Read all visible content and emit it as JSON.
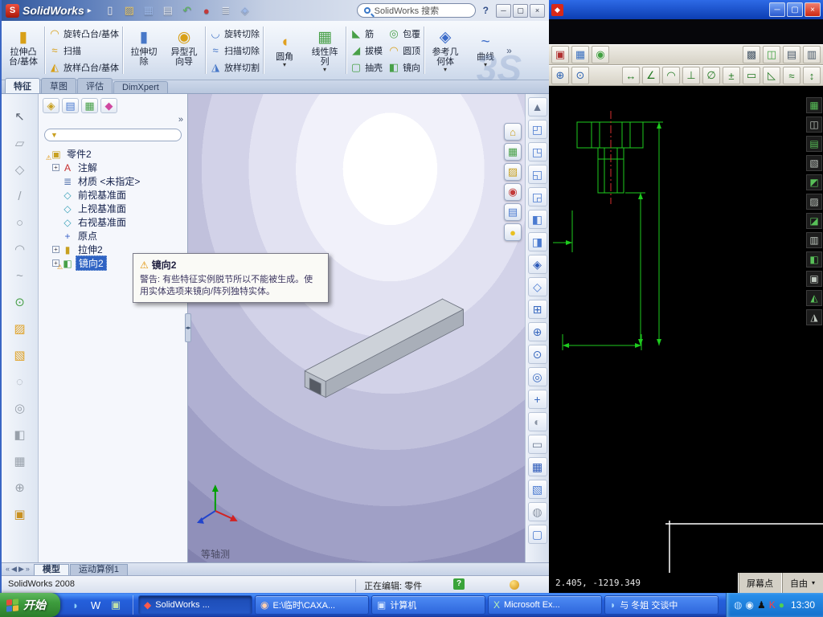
{
  "sw": {
    "titlebar": {
      "logo_text": "SolidWorks",
      "menu_arrow": "▸",
      "tools": [
        {
          "n": "new-document-icon",
          "g": "▯",
          "c": "#f8faff"
        },
        {
          "n": "open-icon",
          "g": "▨",
          "c": "#eac96a"
        },
        {
          "n": "save-icon",
          "g": "▦",
          "c": "#9db9ea"
        },
        {
          "n": "print-icon",
          "g": "▤",
          "c": "#e2e7f0"
        },
        {
          "n": "undo-icon",
          "g": "↶",
          "c": "#5cb85c"
        },
        {
          "n": "select-icon",
          "g": "●",
          "c": "#c23a3a"
        },
        {
          "n": "options-icon",
          "g": "≣",
          "c": "#e2e7f0"
        },
        {
          "n": "rebuild-icon",
          "g": "◈",
          "c": "#9db9ea"
        }
      ],
      "search_value": "SolidWorks 搜索",
      "help_label": "?",
      "win_buttons": [
        {
          "n": "minimize-button",
          "g": "─"
        },
        {
          "n": "maximize-button",
          "g": "▢"
        },
        {
          "n": "close-button",
          "g": "×"
        }
      ]
    },
    "ribbon": {
      "watermark": "3S",
      "b1": {
        "l1": "拉伸凸",
        "l2": "台/基体",
        "g": "▮",
        "c": "#d8a018",
        "ar": ""
      },
      "s1": [
        {
          "t": "旋转凸台/基体",
          "g": "◠",
          "c": "#d8a018"
        },
        {
          "t": "扫描",
          "g": "≈",
          "c": "#d8a018"
        },
        {
          "t": "放样凸台/基体",
          "g": "◭",
          "c": "#d8a018"
        }
      ],
      "b2": {
        "l1": "拉伸切",
        "l2": "除",
        "g": "▮",
        "c": "#4878c8",
        "ar": ""
      },
      "b3": {
        "l1": "异型孔",
        "l2": "向导",
        "g": "◉",
        "c": "#d8a018",
        "ar": ""
      },
      "s2": [
        {
          "t": "旋转切除",
          "g": "◡",
          "c": "#4878c8"
        },
        {
          "t": "扫描切除",
          "g": "≈",
          "c": "#4878c8"
        },
        {
          "t": "放样切割",
          "g": "◮",
          "c": "#4878c8"
        }
      ],
      "b4": {
        "l1": "圆角",
        "l2": "",
        "g": "◖",
        "c": "#e0a020",
        "ar": "▾"
      },
      "b5": {
        "l1": "线性阵",
        "l2": "列",
        "g": "▦",
        "c": "#48a048",
        "ar": "▾"
      },
      "s3": [
        {
          "t": "筋",
          "g": "◣",
          "c": "#48a048"
        },
        {
          "t": "拔模",
          "g": "◢",
          "c": "#48a048"
        },
        {
          "t": "抽壳",
          "g": "▢",
          "c": "#48a048"
        }
      ],
      "s4": [
        {
          "t": "包覆",
          "g": "◎",
          "c": "#48a048"
        },
        {
          "t": "圆顶",
          "g": "◠",
          "c": "#d8a018"
        },
        {
          "t": "镜向",
          "g": "◧",
          "c": "#48a048"
        }
      ],
      "b6": {
        "l1": "参考几",
        "l2": "何体",
        "g": "◈",
        "c": "#3a6ac8",
        "ar": "▾"
      },
      "b7": {
        "l1": "曲线",
        "l2": "",
        "g": "~",
        "c": "#3a6ac8",
        "ar": "▾"
      },
      "overflow": "»"
    },
    "tabs": [
      {
        "label": "特征",
        "cls": "active"
      },
      {
        "label": "草图",
        "cls": ""
      },
      {
        "label": "评估",
        "cls": ""
      },
      {
        "label": "DimXpert",
        "cls": ""
      }
    ],
    "left_tools": [
      {
        "n": "select-arrow-icon",
        "g": "↖",
        "c": "#5a6270"
      },
      {
        "n": "sketch-icon",
        "g": "▱",
        "c": "#98a0aa"
      },
      {
        "n": "dimension-icon",
        "g": "◇",
        "c": "#98a0aa"
      },
      {
        "n": "line-icon",
        "g": "/",
        "c": "#98a0aa"
      },
      {
        "n": "circle-icon",
        "g": "○",
        "c": "#98a0aa"
      },
      {
        "n": "arc-icon",
        "g": "◠",
        "c": "#98a0aa"
      },
      {
        "n": "spline-icon",
        "g": "~",
        "c": "#98a0aa"
      },
      {
        "n": "point-icon",
        "g": "⊙",
        "c": "#48a048"
      },
      {
        "n": "folder-icon",
        "g": "▨",
        "c": "#e0a020"
      },
      {
        "n": "folder-open-icon",
        "g": "▧",
        "c": "#e0a020"
      },
      {
        "n": "trim-icon",
        "g": "◌",
        "c": "#98a0aa"
      },
      {
        "n": "offset-icon",
        "g": "◎",
        "c": "#98a0aa"
      },
      {
        "n": "mirror-sketch-icon",
        "g": "◧",
        "c": "#98a0aa"
      },
      {
        "n": "pattern-icon",
        "g": "▦",
        "c": "#98a0aa"
      },
      {
        "n": "move-icon",
        "g": "⊕",
        "c": "#98a0aa"
      },
      {
        "n": "block-icon",
        "g": "▣",
        "c": "#c89020"
      }
    ],
    "tree_header": {
      "icons": [
        {
          "n": "featuremanager-tab-icon",
          "g": "◈",
          "c": "#c8a020"
        },
        {
          "n": "propertymanager-tab-icon",
          "g": "▤",
          "c": "#4a7ad0"
        },
        {
          "n": "configurationmanager-tab-icon",
          "g": "▦",
          "c": "#48a048"
        },
        {
          "n": "dimxpertmanager-tab-icon",
          "g": "◆",
          "c": "#d048a0"
        }
      ],
      "chevron": "»",
      "filter_icon": "▼"
    },
    "tree": [
      {
        "exp": "",
        "g": "▣",
        "c": "#c8a020",
        "warn": "⚠",
        "label": "零件2",
        "cls": ""
      },
      {
        "exp": "+",
        "g": "A",
        "c": "#c83030",
        "warn": "",
        "label": "注解",
        "cls": "ind"
      },
      {
        "exp": "",
        "g": "≣",
        "c": "#5a78b0",
        "warn": "",
        "label": "材质 <未指定>",
        "cls": "ind"
      },
      {
        "exp": "",
        "g": "◇",
        "c": "#38a0b8",
        "warn": "",
        "label": "前视基准面",
        "cls": "ind"
      },
      {
        "exp": "",
        "g": "◇",
        "c": "#38a0b8",
        "warn": "",
        "label": "上视基准面",
        "cls": "ind"
      },
      {
        "exp": "",
        "g": "◇",
        "c": "#38a0b8",
        "warn": "",
        "label": "右视基准面",
        "cls": "ind"
      },
      {
        "exp": "",
        "g": "+",
        "c": "#3a62c8",
        "warn": "",
        "label": "原点",
        "cls": "ind"
      },
      {
        "exp": "+",
        "g": "▮",
        "c": "#c8a020",
        "warn": "",
        "label": "拉伸2",
        "cls": "ind"
      },
      {
        "exp": "+",
        "g": "◧",
        "c": "#48a048",
        "warn": "⚠",
        "label": "镜向2",
        "cls": "ind selected"
      }
    ],
    "tooltip": {
      "warn": "⚠",
      "title": "镜向2",
      "body": "警告: 有些特征实例脱节所以不能被生成。使用实体选项来镜向/阵列独特实体。"
    },
    "viewport": {
      "cluster": [
        {
          "n": "view-orientation-icon",
          "g": "⌂",
          "c": "#c8a020"
        },
        {
          "n": "zoom-fit-icon",
          "g": "▦",
          "c": "#48a048"
        },
        {
          "n": "scene-icon",
          "g": "▨",
          "c": "#c8a020"
        },
        {
          "n": "section-view-icon",
          "g": "◉",
          "c": "#c23a3a"
        },
        {
          "n": "display-style-icon",
          "g": "▤",
          "c": "#4a7ad0"
        },
        {
          "n": "shadow-icon",
          "g": "●",
          "c": "#e8c020"
        }
      ],
      "iso_label": "等轴测"
    },
    "right_tools": [
      {
        "n": "scroll-up-icon",
        "g": "▲",
        "c": "#6a7890"
      },
      {
        "n": "view-front-icon",
        "g": "◰",
        "c": "#4a7ad0"
      },
      {
        "n": "view-back-icon",
        "g": "◳",
        "c": "#4a7ad0"
      },
      {
        "n": "view-left-icon",
        "g": "◱",
        "c": "#4a7ad0"
      },
      {
        "n": "view-right-icon",
        "g": "◲",
        "c": "#4a7ad0"
      },
      {
        "n": "view-top-icon",
        "g": "◧",
        "c": "#4a7ad0"
      },
      {
        "n": "view-bottom-icon",
        "g": "◨",
        "c": "#4a7ad0"
      },
      {
        "n": "view-isometric-icon",
        "g": "◈",
        "c": "#2a58b8"
      },
      {
        "n": "view-normal-icon",
        "g": "◇",
        "c": "#4a7ad0"
      },
      {
        "n": "zoom-window-icon",
        "g": "⊞",
        "c": "#3a6ac0"
      },
      {
        "n": "zoom-in-out-icon",
        "g": "⊕",
        "c": "#3a6ac0"
      },
      {
        "n": "zoom-area-icon",
        "g": "⊙",
        "c": "#3a6ac0"
      },
      {
        "n": "rotate-view-icon",
        "g": "◎",
        "c": "#3a6ac0"
      },
      {
        "n": "pan-icon",
        "g": "+",
        "c": "#3a6ac0"
      },
      {
        "n": "shaded-icon",
        "g": "◐",
        "c": "#8a94a4"
      },
      {
        "n": "wireframe-icon",
        "g": "▭",
        "c": "#6a7890"
      },
      {
        "n": "section-icon",
        "g": "▦",
        "c": "#2a58b8"
      },
      {
        "n": "camera-icon",
        "g": "▧",
        "c": "#4a7ad0"
      },
      {
        "n": "sphere-icon",
        "g": "◍",
        "c": "#8a94a4"
      },
      {
        "n": "cube-icon",
        "g": "▢",
        "c": "#4a7ad0"
      }
    ],
    "splitter_glyph": "◂▸",
    "bottom": {
      "nav": [
        {
          "g": "«"
        },
        {
          "g": "◀"
        },
        {
          "g": "▶"
        },
        {
          "g": "»"
        }
      ],
      "tabs": [
        {
          "label": "模型",
          "cls": "active"
        },
        {
          "label": "运动算例1",
          "cls": ""
        }
      ]
    },
    "status": {
      "left": "SolidWorks 2008",
      "editing": "正在编辑: 零件",
      "help": "?"
    }
  },
  "caxa": {
    "titlebar": {
      "icons": [
        {
          "n": "caxa-app-icon",
          "g": "◆",
          "c": "#ffffff"
        }
      ],
      "buttons": [
        {
          "n": "minimize-button",
          "g": "─",
          "cls": "blue"
        },
        {
          "n": "restore-button",
          "g": "▢",
          "cls": "blue"
        },
        {
          "n": "close-button",
          "g": "×",
          "cls": "red"
        }
      ]
    },
    "toolbar1_left": [
      {
        "n": "print-icon",
        "g": "▣",
        "c": "#b03030"
      },
      {
        "n": "palette-icon",
        "g": "▦",
        "c": "#3a70c0"
      },
      {
        "n": "stamp-icon",
        "g": "◉",
        "c": "#40a040"
      }
    ],
    "toolbar1_right": [
      {
        "n": "grid-icon",
        "g": "▩",
        "c": "#4a5a6a"
      },
      {
        "n": "layer-icon",
        "g": "◫",
        "c": "#40a040"
      },
      {
        "n": "display-icon",
        "g": "▤",
        "c": "#4a5a6a"
      },
      {
        "n": "settings-icon",
        "g": "▥",
        "c": "#4a5a6a"
      }
    ],
    "toolbar2_left": [
      {
        "n": "zoom-in-icon",
        "g": "⊕",
        "c": "#2a60b0"
      },
      {
        "n": "zoom-out-icon",
        "g": "⊙",
        "c": "#2a60b0"
      }
    ],
    "toolbar2_right": [
      {
        "n": "dim-linear-icon",
        "g": "↔",
        "c": "#207820"
      },
      {
        "n": "dim-angle-icon",
        "g": "∠",
        "c": "#207820"
      },
      {
        "n": "dim-arc-icon",
        "g": "◠",
        "c": "#207820"
      },
      {
        "n": "dim-perpendicular-icon",
        "g": "⊥",
        "c": "#207820"
      },
      {
        "n": "dim-diameter-icon",
        "g": "∅",
        "c": "#207820"
      },
      {
        "n": "dim-tolerance-icon",
        "g": "±",
        "c": "#207820"
      },
      {
        "n": "dim-box-icon",
        "g": "▭",
        "c": "#207820"
      },
      {
        "n": "dim-chamfer-icon",
        "g": "◺",
        "c": "#207820"
      },
      {
        "n": "dim-roughness-icon",
        "g": "≈",
        "c": "#207820"
      },
      {
        "n": "dim-leader-icon",
        "g": "↕",
        "c": "#207820"
      }
    ],
    "side_tools": [
      {
        "n": "layers-icon",
        "g": "▦",
        "c": "#58c058"
      },
      {
        "n": "grid-toggle-icon",
        "g": "◫",
        "c": "#c0c8c0"
      },
      {
        "n": "ortho-icon",
        "g": "▤",
        "c": "#58c058"
      },
      {
        "n": "linewidth-icon",
        "g": "▧",
        "c": "#c0c8c0"
      },
      {
        "n": "dynamic-input-icon",
        "g": "◩",
        "c": "#58c058"
      },
      {
        "n": "snap-icon",
        "g": "▨",
        "c": "#c0c8c0"
      },
      {
        "n": "polar-icon",
        "g": "◪",
        "c": "#58c058"
      },
      {
        "n": "tracking-icon",
        "g": "▥",
        "c": "#c0c8c0"
      },
      {
        "n": "units-icon",
        "g": "◧",
        "c": "#58c058"
      },
      {
        "n": "properties-icon",
        "g": "▣",
        "c": "#c0c8c0"
      },
      {
        "n": "osnap-icon",
        "g": "◭",
        "c": "#58c058"
      },
      {
        "n": "dimstyle-icon",
        "g": "◮",
        "c": "#c0c8c0"
      }
    ],
    "status": {
      "coords": "2.405, -1219.349",
      "snap": "屏幕点",
      "mode": "自由",
      "dropdown": "▾"
    }
  },
  "taskbar": {
    "start_label": "开始",
    "quick_launch": [
      {
        "n": "browser-icon",
        "g": "◗",
        "c": "#8fd0f8"
      },
      {
        "n": "word-icon",
        "g": "W",
        "c": "#ffffff"
      },
      {
        "n": "show-desktop-icon",
        "g": "▣",
        "c": "#bfe0a8"
      }
    ],
    "tasks": [
      {
        "n": "task-solidworks",
        "icon": "◆",
        "ic": "#ff5a4a",
        "label": "SolidWorks ...",
        "cls": "active"
      },
      {
        "n": "task-caxa",
        "icon": "◉",
        "ic": "#ffd0b0",
        "label": "E:\\临时\\CAXA...",
        "cls": ""
      },
      {
        "n": "task-computer",
        "icon": "▣",
        "ic": "#cfe2ff",
        "label": "计算机",
        "cls": ""
      },
      {
        "n": "task-excel",
        "icon": "X",
        "ic": "#b8f0b8",
        "label": "Microsoft Ex...",
        "cls": ""
      },
      {
        "n": "task-qq-chat",
        "icon": "◗",
        "ic": "#a8d8ff",
        "label": "与 冬姐 交谈中",
        "cls": ""
      }
    ],
    "tray_icons": [
      {
        "n": "network-icon",
        "g": "◍",
        "c": "#bfe0ff"
      },
      {
        "n": "volume-icon",
        "g": "◉",
        "c": "#e8f4ff"
      },
      {
        "n": "qq-icon",
        "g": "♟",
        "c": "#101010"
      },
      {
        "n": "antivirus-icon",
        "g": "K",
        "c": "#ff4040"
      },
      {
        "n": "im-icon",
        "g": "●",
        "c": "#50d050"
      }
    ],
    "clock": "13:30"
  }
}
